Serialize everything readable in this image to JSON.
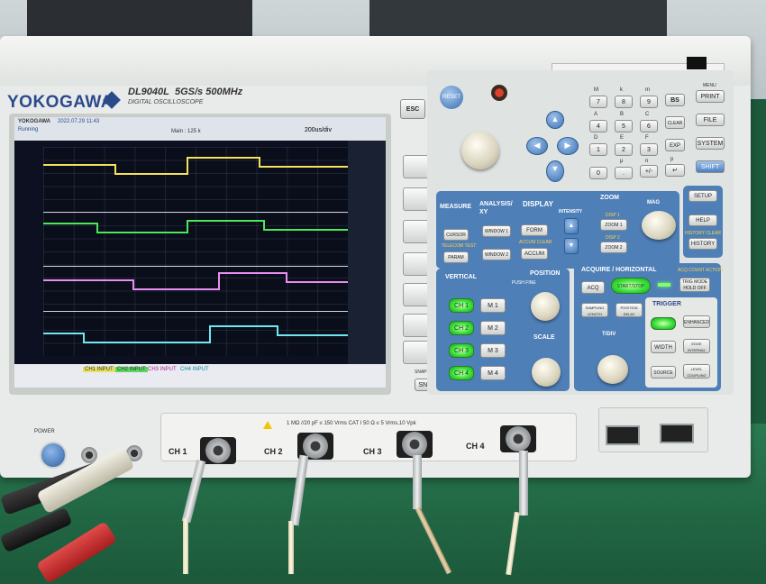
{
  "device": {
    "brand": "YOKOGAWA",
    "model": "DL9040L",
    "spec": "5GS/s 500MHz",
    "subtitle": "DIGITAL OSCILLOSCOPE"
  },
  "screen": {
    "header_brand": "YOKOGAWA",
    "header_time": "2022.07.29 11:43",
    "running": "Running",
    "main_label": "Main : 125 k",
    "timebase": "200us/div",
    "footer": [
      "CH1 INPUT",
      "CH2 INPUT",
      "CH3 INPUT",
      "CH4 INPUT"
    ],
    "trace_colors": [
      "#f6e15a",
      "#4ee65a",
      "#e88ef0",
      "#6fe8f0"
    ]
  },
  "buttons": {
    "esc": "ESC",
    "reset": "RESET",
    "snap_clear": "SNAP CLEAR",
    "snap": "SNAP",
    "keypad": {
      "row1": [
        "7",
        "8",
        "9",
        "BS"
      ],
      "row2": [
        "4",
        "5",
        "6",
        "CLEAR"
      ],
      "row3": [
        "1",
        "2",
        "3",
        "EXP"
      ],
      "row4": [
        "0",
        ".",
        "+/-",
        "↵"
      ],
      "row1_top": [
        "M",
        "k",
        "m",
        ""
      ],
      "row2_top": [
        "A",
        "B",
        "C",
        ""
      ],
      "row3_top": [
        "D",
        "E",
        "F",
        ""
      ],
      "row4_top": [
        "",
        "μ",
        "n",
        "p"
      ]
    },
    "menu": "MENU",
    "print": "PRINT",
    "file": "FILE",
    "system": "SYSTEM",
    "shift": "SHIFT",
    "measure": "MEASURE",
    "analysis": "ANALYSIS/ XY",
    "display": "DISPLAY",
    "zoom": "ZOOM",
    "mag": "MAG",
    "setup": "SETUP",
    "help": "HELP",
    "history_clear": "HISTORY CLEAR",
    "history": "HISTORY",
    "cursor": "CURSOR",
    "telecom_test": "TELECOM TEST",
    "param": "PARAM",
    "window1": "WINDOW 1",
    "window2": "WINDOW 2",
    "form": "FORM",
    "accum_clear": "ACCUM CLEAR",
    "accum": "ACCUM",
    "intensity": "INTENSITY",
    "disp1": "DISP 1",
    "zoom1": "ZOOM 1",
    "disp2": "DISP 2",
    "zoom2": "ZOOM 2",
    "vertical": "VERTICAL",
    "position": "POSITION",
    "push_fine": "PUSH FINE",
    "scale": "SCALE",
    "ch": [
      "CH 1",
      "CH 2",
      "CH 3",
      "CH 4"
    ],
    "math": [
      "M 1",
      "M 2",
      "M 3",
      "M 4"
    ],
    "acquire_horizontal": "ACQUIRE / HORIZONTAL",
    "acq_count_action": "ACQ COUNT ACTION",
    "acq": "ACQ",
    "start_stop": "START/STOP",
    "trig_mode": "TRIG MODE HOLD OFF",
    "sampling_length": "SAMPLING LENGTH",
    "position_delay": "POSITION DELAY",
    "tdiv": "T/DIV",
    "trigger": "TRIGGER",
    "enhanced": "ENHANCED",
    "width": "WIDTH",
    "edge_internal": "EDGE INTERNAL",
    "source": "SOURCE",
    "level_coupling": "LEVEL COUPLING",
    "power": "POWER"
  },
  "front": {
    "input_spec": "1 MΩ //20 pF ≤ 150 Vrms  CAT I  50 Ω ≤ 5 Vrms,10 Vpk",
    "channels": [
      "CH 1",
      "CH 2",
      "CH 3",
      "CH 4"
    ]
  }
}
